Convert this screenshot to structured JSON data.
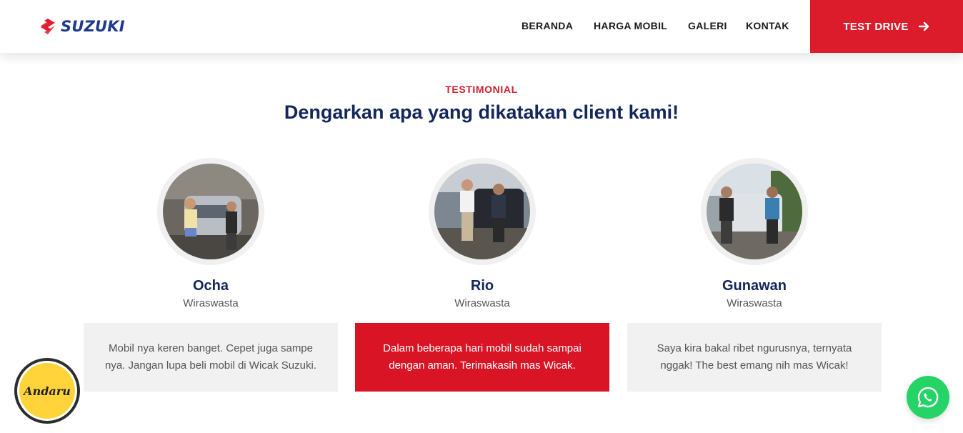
{
  "header": {
    "logo_text": "SUZUKI",
    "nav": [
      "BERANDA",
      "HARGA MOBIL",
      "GALERI",
      "KONTAK"
    ],
    "cta_label": "TEST DRIVE"
  },
  "section": {
    "eyebrow": "TESTIMONIAL",
    "heading": "Dengarkan apa yang dikatakan client kami!"
  },
  "testimonials": [
    {
      "name": "Ocha",
      "role": "Wiraswasta",
      "quote": "Mobil nya keren banget. Cepet juga sampe nya. Jangan lupa beli mobil di Wicak Suzuki."
    },
    {
      "name": "Rio",
      "role": "Wiraswasta",
      "quote": "Dalam beberapa hari mobil sudah sampai dengan aman. Terimakasih mas Wicak."
    },
    {
      "name": "Gunawan",
      "role": "Wiraswasta",
      "quote": "Saya kira bakal ribet ngurusnya, ternyata nggak! The best emang nih mas Wicak!"
    }
  ],
  "floating": {
    "badge_text": "Andaru",
    "whatsapp_icon": "whatsapp-icon"
  },
  "colors": {
    "brand_red": "#dc1b2b",
    "navy": "#12275a",
    "whatsapp_green": "#25d366"
  }
}
